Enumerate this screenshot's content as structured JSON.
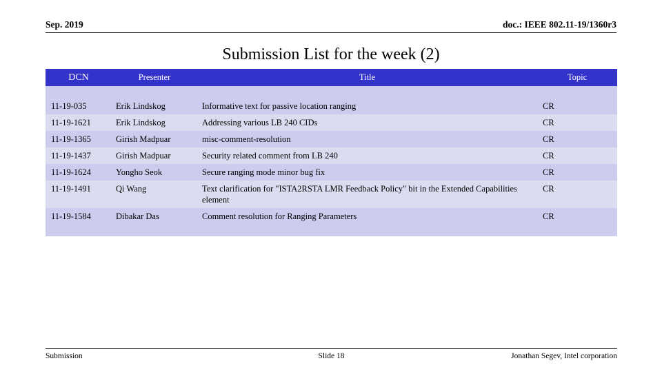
{
  "header": {
    "left": "Sep. 2019",
    "right": "doc.: IEEE 802.11-19/1360r3"
  },
  "title": "Submission List for the week (2)",
  "table": {
    "columns": [
      "DCN",
      "Presenter",
      "Title",
      "Topic"
    ],
    "rows": [
      {
        "dcn": "11-19-035",
        "presenter": "Erik Lindskog",
        "title": "Informative text for passive location ranging",
        "topic": "CR"
      },
      {
        "dcn": "11-19-1621",
        "presenter": "Erik Lindskog",
        "title": "Addressing various LB 240 CIDs",
        "topic": "CR"
      },
      {
        "dcn": "11-19-1365",
        "presenter": "Girish Madpuar",
        "title": "misc-comment-resolution",
        "topic": "CR"
      },
      {
        "dcn": "11-19-1437",
        "presenter": "Girish Madpuar",
        "title": "Security related comment from LB 240",
        "topic": "CR"
      },
      {
        "dcn": "11-19-1624",
        "presenter": "Yongho Seok",
        "title": "Secure ranging mode minor bug fix",
        "topic": "CR"
      },
      {
        "dcn": "11-19-1491",
        "presenter": "Qi Wang",
        "title": "Text clarification for \"ISTA2RSTA LMR Feedback Policy\" bit in the Extended Capabilities element",
        "topic": "CR"
      },
      {
        "dcn": "11-19-1584",
        "presenter": "Dibakar Das",
        "title": "Comment resolution for Ranging Parameters",
        "topic": "CR"
      }
    ]
  },
  "footer": {
    "left": "Submission",
    "center": "Slide 18",
    "right": "Jonathan Segev, Intel corporation"
  },
  "colors": {
    "header_band": "#3333cc",
    "row_fill": "#ccccee",
    "row_fill_alt": "#dcdcf0"
  }
}
